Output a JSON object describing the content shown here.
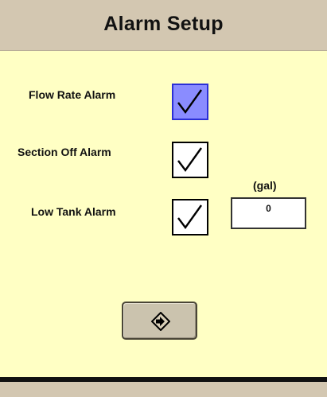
{
  "header": {
    "title": "Alarm Setup"
  },
  "alarms": [
    {
      "label": "Flow Rate Alarm",
      "checked": true,
      "selected": true
    },
    {
      "label": "Section Off Alarm",
      "checked": true,
      "selected": false
    },
    {
      "label": "Low Tank Alarm",
      "checked": true,
      "selected": false
    }
  ],
  "low_tank": {
    "unit": "(gal)",
    "value": "0"
  },
  "next_button": {
    "icon": "arrow-right-diamond-icon"
  },
  "colors": {
    "background": "#ffffc4",
    "header": "#d3c7b1",
    "selected_fill": "#8a8cff",
    "selected_border": "#2b2fd6"
  }
}
